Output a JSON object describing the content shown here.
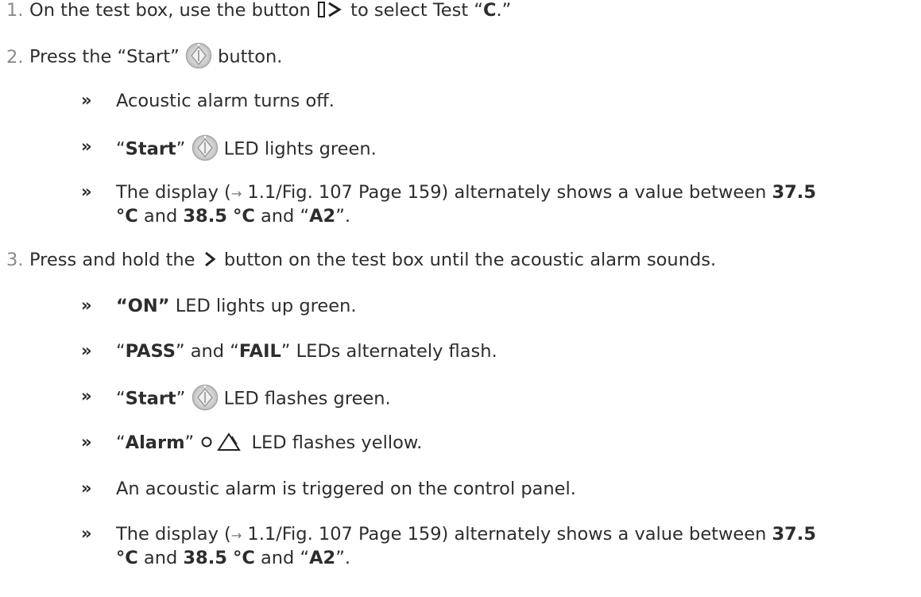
{
  "bullet": "»",
  "step1": {
    "num": "1.",
    "t1": "On the test box, use the button",
    "t2": "to select Test “",
    "bold": "C",
    "t3": ".”"
  },
  "step2": {
    "num": "2.",
    "t1": "Press the “Start”",
    "t2": "button.",
    "results": {
      "r1": "Acoustic alarm turns off.",
      "r2": {
        "q1": "“",
        "bold": "Start",
        "q2": "”",
        "rest": "LED lights green."
      },
      "r3": {
        "t1": "The display (",
        "arrow": "→",
        "t2": " 1.1/Fig. 107 Page 159) alternately shows a value between ",
        "b1": "37.5",
        "b1b": "°C",
        "and1": " and ",
        "b2": "38.5",
        "sp": " ",
        "b2b": "°C",
        "and2": " and “",
        "b3": "A2",
        "end": "”."
      }
    }
  },
  "step3": {
    "num": "3.",
    "t1": "Press and hold the",
    "t2": "button on the test box until the acoustic alarm sounds.",
    "results": {
      "r1": {
        "bold": "“ON”",
        "rest": " LED lights up green."
      },
      "r2": {
        "q1": "“",
        "b1": "PASS",
        "mid": "” and “",
        "b2": "FAIL",
        "rest": "” LEDs alternately flash."
      },
      "r3": {
        "q1": "“",
        "bold": "Start",
        "q2": "”",
        "rest": "LED flashes green."
      },
      "r4": {
        "q1": "“",
        "bold": "Alarm",
        "q2": "”",
        "rest": "LED flashes yellow."
      },
      "r5": "An acoustic alarm is triggered on the control panel.",
      "r6": {
        "t1": "The display (",
        "arrow": "→",
        "t2": " 1.1/Fig. 107 Page 159) alternately shows a value between ",
        "b1": "37.5",
        "b1b": "°C",
        "and1": " and ",
        "b2": "38.5",
        "sp": " ",
        "b2b": "°C",
        "and2": " and “",
        "b3": "A2",
        "end": "”."
      }
    }
  },
  "colors": {
    "text": "#2d2d2d",
    "number": "#8a8a8a",
    "button_fill": "#c6c6c6",
    "button_ring": "#a9a9a9"
  }
}
